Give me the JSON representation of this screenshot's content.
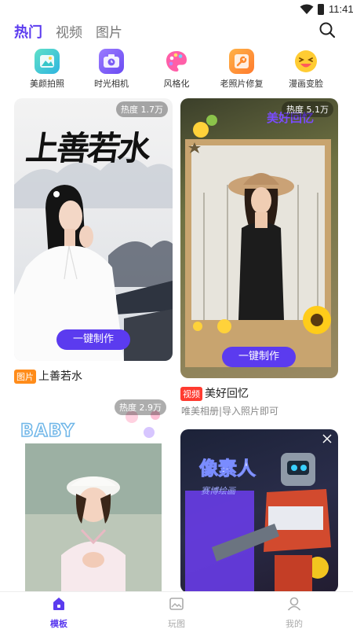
{
  "status_bar": {
    "time": "11:41"
  },
  "top_tabs": [
    {
      "label": "热门",
      "active": true
    },
    {
      "label": "视频",
      "active": false
    },
    {
      "label": "图片",
      "active": false
    }
  ],
  "features": [
    {
      "label": "美颜拍照",
      "icon": "beauty-camera-icon"
    },
    {
      "label": "时光相机",
      "icon": "time-camera-icon"
    },
    {
      "label": "风格化",
      "icon": "palette-icon"
    },
    {
      "label": "老照片修复",
      "icon": "repair-wrench-icon"
    },
    {
      "label": "漫画变脸",
      "icon": "laughing-face-icon"
    }
  ],
  "cards": [
    {
      "heat": "热度 1.7万",
      "art_text": "上善若水",
      "button": "一键制作",
      "tag": "图片",
      "title": "上善若水"
    },
    {
      "heat": "热度 5.1万",
      "art_text": "美好回忆",
      "button": "一键制作",
      "tag": "视频",
      "title": "美好回忆",
      "subtitle": "唯美相册|导入照片即可"
    },
    {
      "heat": "热度 2.9万",
      "art_text": "BABY"
    },
    {
      "art_text": "像素人",
      "art_subtext": "赛博绘画"
    }
  ],
  "bottom_nav": [
    {
      "label": "模板",
      "active": true,
      "icon": "home-icon"
    },
    {
      "label": "玩图",
      "active": false,
      "icon": "gallery-icon"
    },
    {
      "label": "我的",
      "active": false,
      "icon": "user-icon"
    }
  ],
  "colors": {
    "accent": "#5b3bef",
    "tag_image": "#ff8c1a",
    "tag_video": "#ff3b30"
  }
}
